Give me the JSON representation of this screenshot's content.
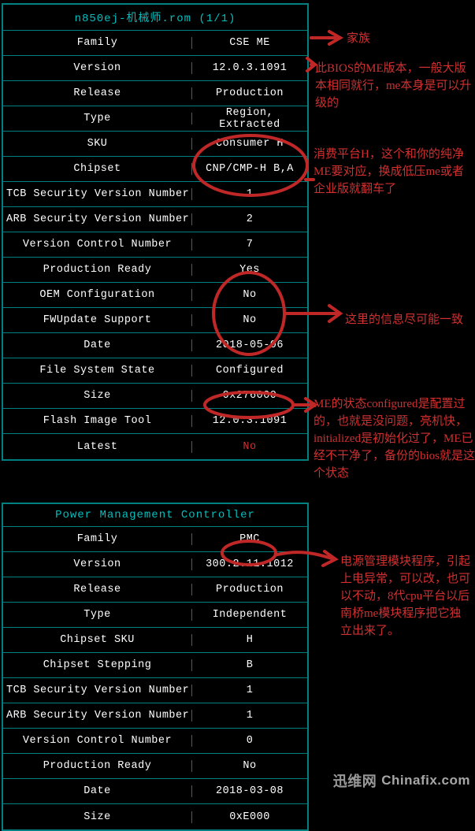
{
  "table1": {
    "header": "n850ej-机械师.rom (1/1)",
    "rows": [
      {
        "label": "Family",
        "value": "CSE ME"
      },
      {
        "label": "Version",
        "value": "12.0.3.1091"
      },
      {
        "label": "Release",
        "value": "Production"
      },
      {
        "label": "Type",
        "value": "Region, Extracted"
      },
      {
        "label": "SKU",
        "value": "Consumer H"
      },
      {
        "label": "Chipset",
        "value": "CNP/CMP-H B,A"
      },
      {
        "label": "TCB Security Version Number",
        "value": "1"
      },
      {
        "label": "ARB Security Version Number",
        "value": "2"
      },
      {
        "label": "Version Control Number",
        "value": "7"
      },
      {
        "label": "Production Ready",
        "value": "Yes"
      },
      {
        "label": "OEM Configuration",
        "value": "No"
      },
      {
        "label": "FWUpdate Support",
        "value": "No"
      },
      {
        "label": "Date",
        "value": "2018-05-06"
      },
      {
        "label": "File System State",
        "value": "Configured"
      },
      {
        "label": "Size",
        "value": "0x276000"
      },
      {
        "label": "Flash Image Tool",
        "value": "12.0.3.1091"
      },
      {
        "label": "Latest",
        "value": "No",
        "red": true
      }
    ]
  },
  "table2": {
    "header": "Power Management Controller",
    "rows": [
      {
        "label": "Family",
        "value": "PMC"
      },
      {
        "label": "Version",
        "value": "300.2.11.1012"
      },
      {
        "label": "Release",
        "value": "Production"
      },
      {
        "label": "Type",
        "value": "Independent"
      },
      {
        "label": "Chipset SKU",
        "value": "H"
      },
      {
        "label": "Chipset Stepping",
        "value": "B"
      },
      {
        "label": "TCB Security Version Number",
        "value": "1"
      },
      {
        "label": "ARB Security Version Number",
        "value": "1"
      },
      {
        "label": "Version Control Number",
        "value": "0"
      },
      {
        "label": "Production Ready",
        "value": "No"
      },
      {
        "label": "Date",
        "value": "2018-03-08"
      },
      {
        "label": "Size",
        "value": "0xE000"
      }
    ]
  },
  "annotations": {
    "a1": "家族",
    "a2": "此BIOS的ME版本，一般大版本相同就行，me本身是可以升级的",
    "a3": "消费平台H，这个和你的纯净ME要对应，换成低压me或者企业版就翻车了",
    "a4": "这里的信息尽可能一致",
    "a5": "ME的状态configured是配置过的，也就是没问题，亮机快，initialized是初始化过了，ME已经不干净了，备份的bios就是这个状态",
    "a6": "电源管理模块程序，引起上电异常，可以改，也可以不动，8代cpu平台以后南桥me模块程序把它独立出来了。"
  },
  "watermark": {
    "zh": "迅维网",
    "domain": "Chinafix.com"
  }
}
